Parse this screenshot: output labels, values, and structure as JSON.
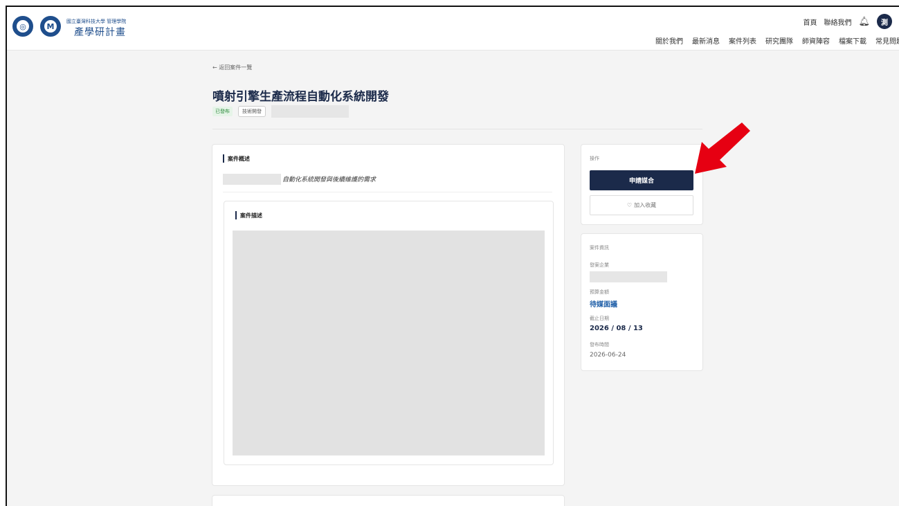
{
  "header": {
    "school_name": "國立臺灣科技大學 管理學院",
    "project_name": "產學研計畫",
    "top_links": [
      "首頁",
      "聯絡我們"
    ],
    "avatar_initial": "測",
    "nav": [
      "關於我們",
      "最新消息",
      "案件列表",
      "研究團隊",
      "師資陣容",
      "檔案下載",
      "常見問題"
    ]
  },
  "page": {
    "back_link": "← 返回案件一覽",
    "title": "噴射引擎生產流程自動化系統開發",
    "status_tag": "已發布",
    "category_tag": "技術開發"
  },
  "summary": {
    "heading": "案件概述",
    "text": "自動化系統開發與後續維護的需求"
  },
  "description": {
    "heading": "案件描述"
  },
  "actions": {
    "heading": "操作",
    "apply_label": "申請媒合",
    "favorite_label": "加入收藏",
    "favorite_icon": "♡"
  },
  "case_info": {
    "heading": "案件資訊",
    "company_label": "發案企業",
    "budget_label": "預算金額",
    "budget_value": "待媒面議",
    "deadline_label": "截止日期",
    "deadline_value": "2026 / 08 / 13",
    "published_label": "發布時間",
    "published_value": "2026-06-24"
  },
  "colors": {
    "primary": "#1b2a4a",
    "accent_link": "#1f5fa8",
    "annotation_arrow": "#e60012"
  }
}
